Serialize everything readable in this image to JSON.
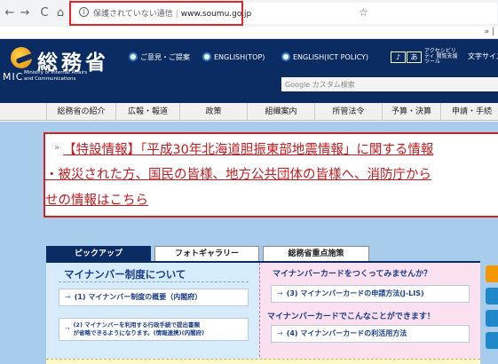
{
  "browser": {
    "nav": {
      "back": "←",
      "forward": "→",
      "reload": "C",
      "home": "⌂"
    },
    "url": {
      "info": "i",
      "security_label": "保護されていない通信",
      "separator": "|",
      "domain": "www.soumu.go.jp"
    },
    "star": "☆",
    "more": "» | "
  },
  "header": {
    "logo_text": "総務省",
    "logo_mic": "MIC",
    "ministry_name": "Ministry of Internal Affairs and Communications",
    "links": [
      {
        "label": "ご意見・ご提案"
      },
      {
        "label": "ENGLISH(TOP)"
      },
      {
        "label": "ENGLISH(ICT POLICY)"
      }
    ],
    "a11y": {
      "btn1": "♪",
      "btn2": "あ",
      "text": "アクセシビリティ 閲覧支援ツール"
    },
    "font_size_label": "文字サイズ",
    "search_placeholder": "Google カスタム検索"
  },
  "gnav": [
    "総務省の紹介",
    "広報・報道",
    "政策",
    "組織案内",
    "所管法令",
    "予算・決算",
    "申請・手続"
  ],
  "alert": {
    "raquo": "»",
    "line1": "【特設情報】「平成30年北海道胆振東部地震情報」に関する情報",
    "line2": "・被災された方、国民の皆様、地方公共団体の皆様へ、消防庁から",
    "line3": "せの情報はこちら"
  },
  "tabs": [
    "ピックアップ",
    "フォトギャラリー",
    "総務省重点施策"
  ],
  "panel": {
    "left_heading": "マイナンバー制度について",
    "left_links": [
      {
        "arrow": "→",
        "label": "(1) マイナンバー制度の概要（内閣府）"
      },
      {
        "arrow": "→",
        "line1": "(2) マイナンバーを利用する行政手続で提出書類",
        "line2": "が省略できるようになります。(情報連携)(内閣府)"
      }
    ],
    "right_heading1": "マイナンバーカードをつくってみませんか？",
    "right_links1": [
      {
        "arrow": "→",
        "label": "(3) マイナンバーカードの申請方法(J-LIS)"
      }
    ],
    "right_heading2": "マイナンバーカードでこんなことができます！",
    "right_links2": [
      {
        "arrow": "→",
        "label": "(4) マイナンバーカードの利活用方法"
      }
    ]
  },
  "colors": {
    "header_bg": "#0b2b63",
    "alert_red": "#c8191d",
    "page_bg": "#a7ccec",
    "right_icons": [
      "#f39800",
      "#1e88c9",
      "#1e88c9",
      "#1e88c9"
    ]
  }
}
